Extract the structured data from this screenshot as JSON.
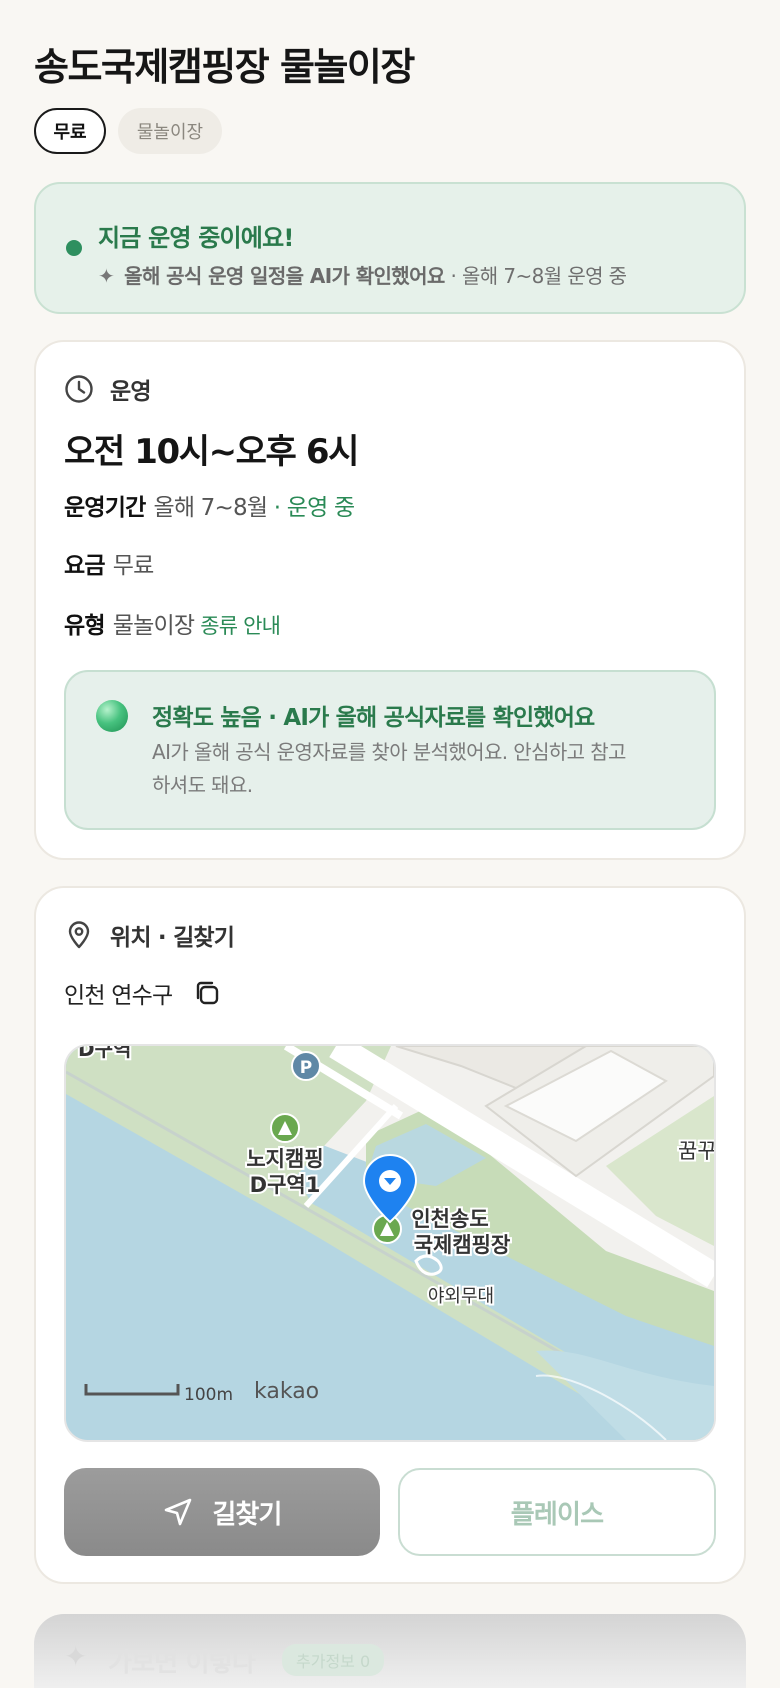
{
  "title": "송도국제캠핑장 물놀이장",
  "chips": {
    "free": "무료",
    "type": "물놀이장"
  },
  "status": {
    "title": "지금 운영 중이에요!",
    "sub_bold": "올해 공식 운영 일정을 AI가 확인했어요",
    "sub_rest": " · 올해 7~8월 운영 중"
  },
  "ops": {
    "section": "운영",
    "hours": "오전 10시~오후 6시",
    "period_label": "운영기간",
    "period_value": "올해 7~8월",
    "period_status": " · 운영 중",
    "fee_label": "요금",
    "fee_value": "무료",
    "type_label": "유형",
    "type_value": "물놀이장",
    "type_link": "종류 안내",
    "accuracy_title": "정확도 높음 · AI가 올해 공식자료를 확인했어요",
    "accuracy_body": "AI가 올해 공식 운영자료를 찾아 분석했어요. 안심하고 참고하셔도 돼요."
  },
  "location": {
    "section": "위치 · 길찾기",
    "address": "인천 연수구",
    "map": {
      "labels": {
        "top_cut": "D구역",
        "nojicamp_1": "노지캠핑",
        "nojicamp_2": "D구역1",
        "campsite_1": "인천송도",
        "campsite_2": "국제캠핑장",
        "stage": "야외무대",
        "right_cut": "꿈꾸",
        "scale": "100m",
        "brand": "kakao",
        "parking": "P"
      }
    },
    "route_button": "길찾기",
    "place_button": "플레이스"
  },
  "bottom": {
    "title": "가보면 이렇다",
    "badge": "추가정보 0"
  },
  "colors": {
    "accent_green": "#2a8a56",
    "status_bg": "#e6f1ea",
    "pin_blue": "#1e82f0"
  }
}
